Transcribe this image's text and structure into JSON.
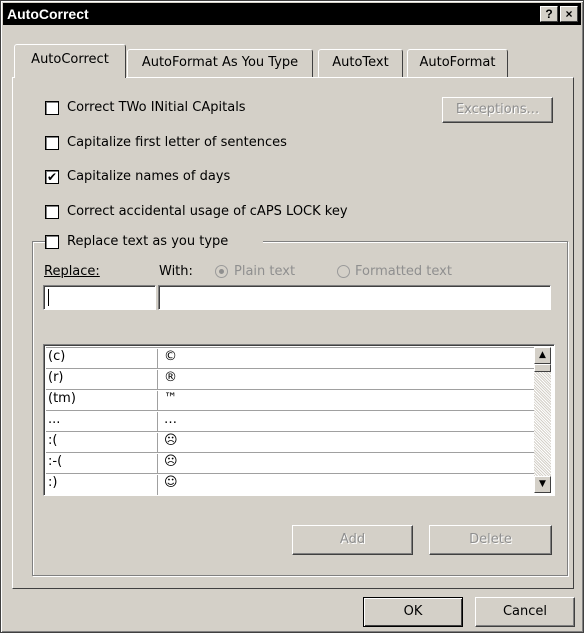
{
  "window": {
    "title": "AutoCorrect",
    "help_button": "?",
    "close_button": "×"
  },
  "tabs": [
    {
      "label": "AutoCorrect",
      "active": true
    },
    {
      "label": "AutoFormat As You Type",
      "active": false
    },
    {
      "label": "AutoText",
      "active": false
    },
    {
      "label": "AutoFormat",
      "active": false
    }
  ],
  "options": [
    {
      "label": "Correct TWo INitial CApitals",
      "checked": false
    },
    {
      "label": "Capitalize first letter of sentences",
      "checked": false
    },
    {
      "label": "Capitalize names of days",
      "checked": true
    },
    {
      "label": "Correct accidental usage of cAPS LOCK key",
      "checked": false
    }
  ],
  "exceptions_button": "Exceptions...",
  "replace_group": {
    "label": "Replace text as you type",
    "checked": false,
    "replace_label": "Replace:",
    "with_label": "With:",
    "radio_plain": "Plain text",
    "radio_formatted": "Formatted text",
    "selected_radio": "plain",
    "replace_value": "",
    "with_value": ""
  },
  "entries": [
    {
      "from": "(c)",
      "to": "©"
    },
    {
      "from": "(r)",
      "to": "®"
    },
    {
      "from": "(tm)",
      "to": "™"
    },
    {
      "from": "...",
      "to": "…"
    },
    {
      "from": ":(",
      "to": "☹"
    },
    {
      "from": ":-(",
      "to": "☹"
    },
    {
      "from": ":)",
      "to": "☺"
    }
  ],
  "scroll_up": "▲",
  "scroll_down": "▼",
  "add_button": "Add",
  "delete_button": "Delete",
  "ok_button": "OK",
  "cancel_button": "Cancel"
}
